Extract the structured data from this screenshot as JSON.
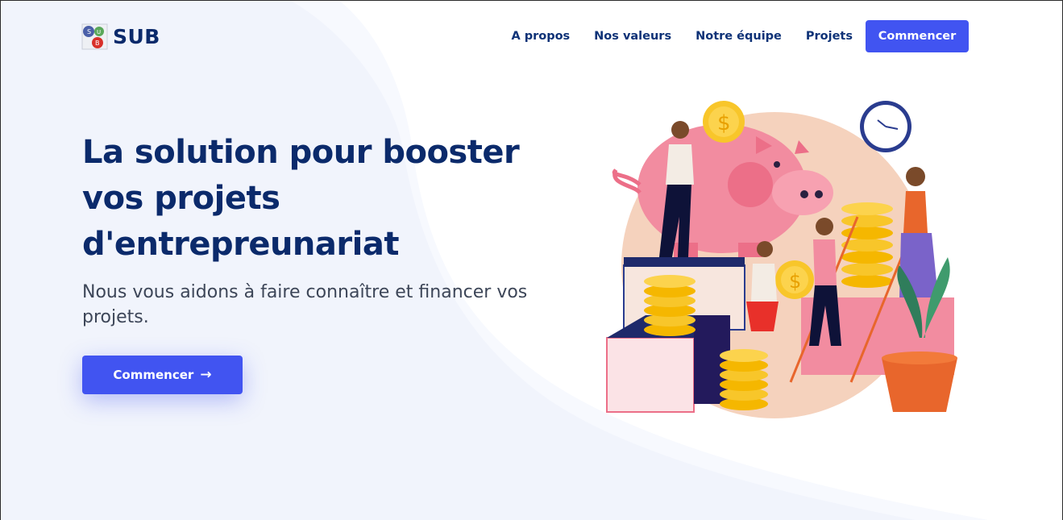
{
  "brand": {
    "name": "SUB",
    "logo_icon": "sub-logo-icon"
  },
  "nav": {
    "items": [
      {
        "label": "A propos"
      },
      {
        "label": "Nos valeurs"
      },
      {
        "label": "Notre équipe"
      },
      {
        "label": "Projets"
      }
    ],
    "cta_label": "Commencer"
  },
  "hero": {
    "title": "La solution pour booster vos projets d'entrepreunariat",
    "subtitle": "Nous vous aidons à faire connaître et financer vos projets.",
    "cta_label": "Commencer",
    "cta_icon": "arrow-right-icon",
    "illustration_icon": "finance-illustration"
  },
  "colors": {
    "primary": "#4154f1",
    "heading": "#0b2a6b",
    "text": "#3d4658",
    "background_blob": "#f1f4fc"
  }
}
